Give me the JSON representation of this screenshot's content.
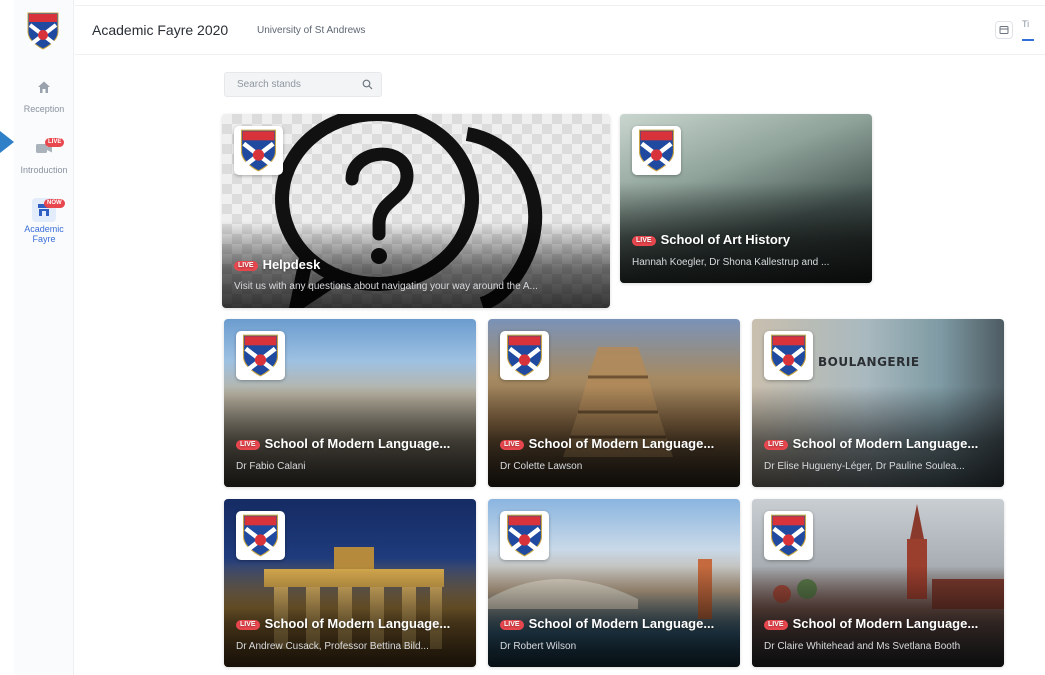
{
  "app": {
    "title": "Academic Fayre 2020",
    "organisation": "University of St Andrews",
    "tab_fragment": "Ti"
  },
  "sidebar": {
    "items": [
      {
        "label": "Reception",
        "icon": "home-icon"
      },
      {
        "label": "Introduction",
        "icon": "video-camera-icon",
        "badge": "LIVE"
      },
      {
        "label": "Academic Fayre",
        "icon": "booth-icon",
        "badge": "NOW",
        "active": true
      }
    ]
  },
  "search": {
    "placeholder": "Search stands"
  },
  "stands": [
    {
      "title": "Helpdesk",
      "subtitle": "Visit us with any questions about navigating your way around the A...",
      "live": "LIVE"
    },
    {
      "title": "School of Art History",
      "subtitle": "Hannah Koegler, Dr Shona Kallestrup and ...",
      "live": "LIVE"
    },
    {
      "title": "School of Modern Language...",
      "subtitle": "Dr Fabio Calani",
      "live": "LIVE"
    },
    {
      "title": "School of Modern Language...",
      "subtitle": "Dr Colette Lawson",
      "live": "LIVE"
    },
    {
      "title": "School of Modern Language...",
      "subtitle": "Dr Elise Hugueny-Léger, Dr Pauline Soulea...",
      "live": "LIVE"
    },
    {
      "title": "School of Modern Language...",
      "subtitle": "Dr Andrew Cusack, Professor Bettina Bild...",
      "live": "LIVE"
    },
    {
      "title": "School of Modern Language...",
      "subtitle": "Dr Robert Wilson",
      "live": "LIVE"
    },
    {
      "title": "School of Modern Language...",
      "subtitle": "Dr Claire Whitehead and Ms Svetlana Booth",
      "live": "LIVE"
    }
  ],
  "image_text": {
    "boulangerie_sign": "BOULANGERIE"
  },
  "colors": {
    "live_badge": "#e8474e",
    "accent": "#2f6fd6",
    "crest_blue": "#1f4aa0",
    "crest_red": "#d8323a"
  }
}
